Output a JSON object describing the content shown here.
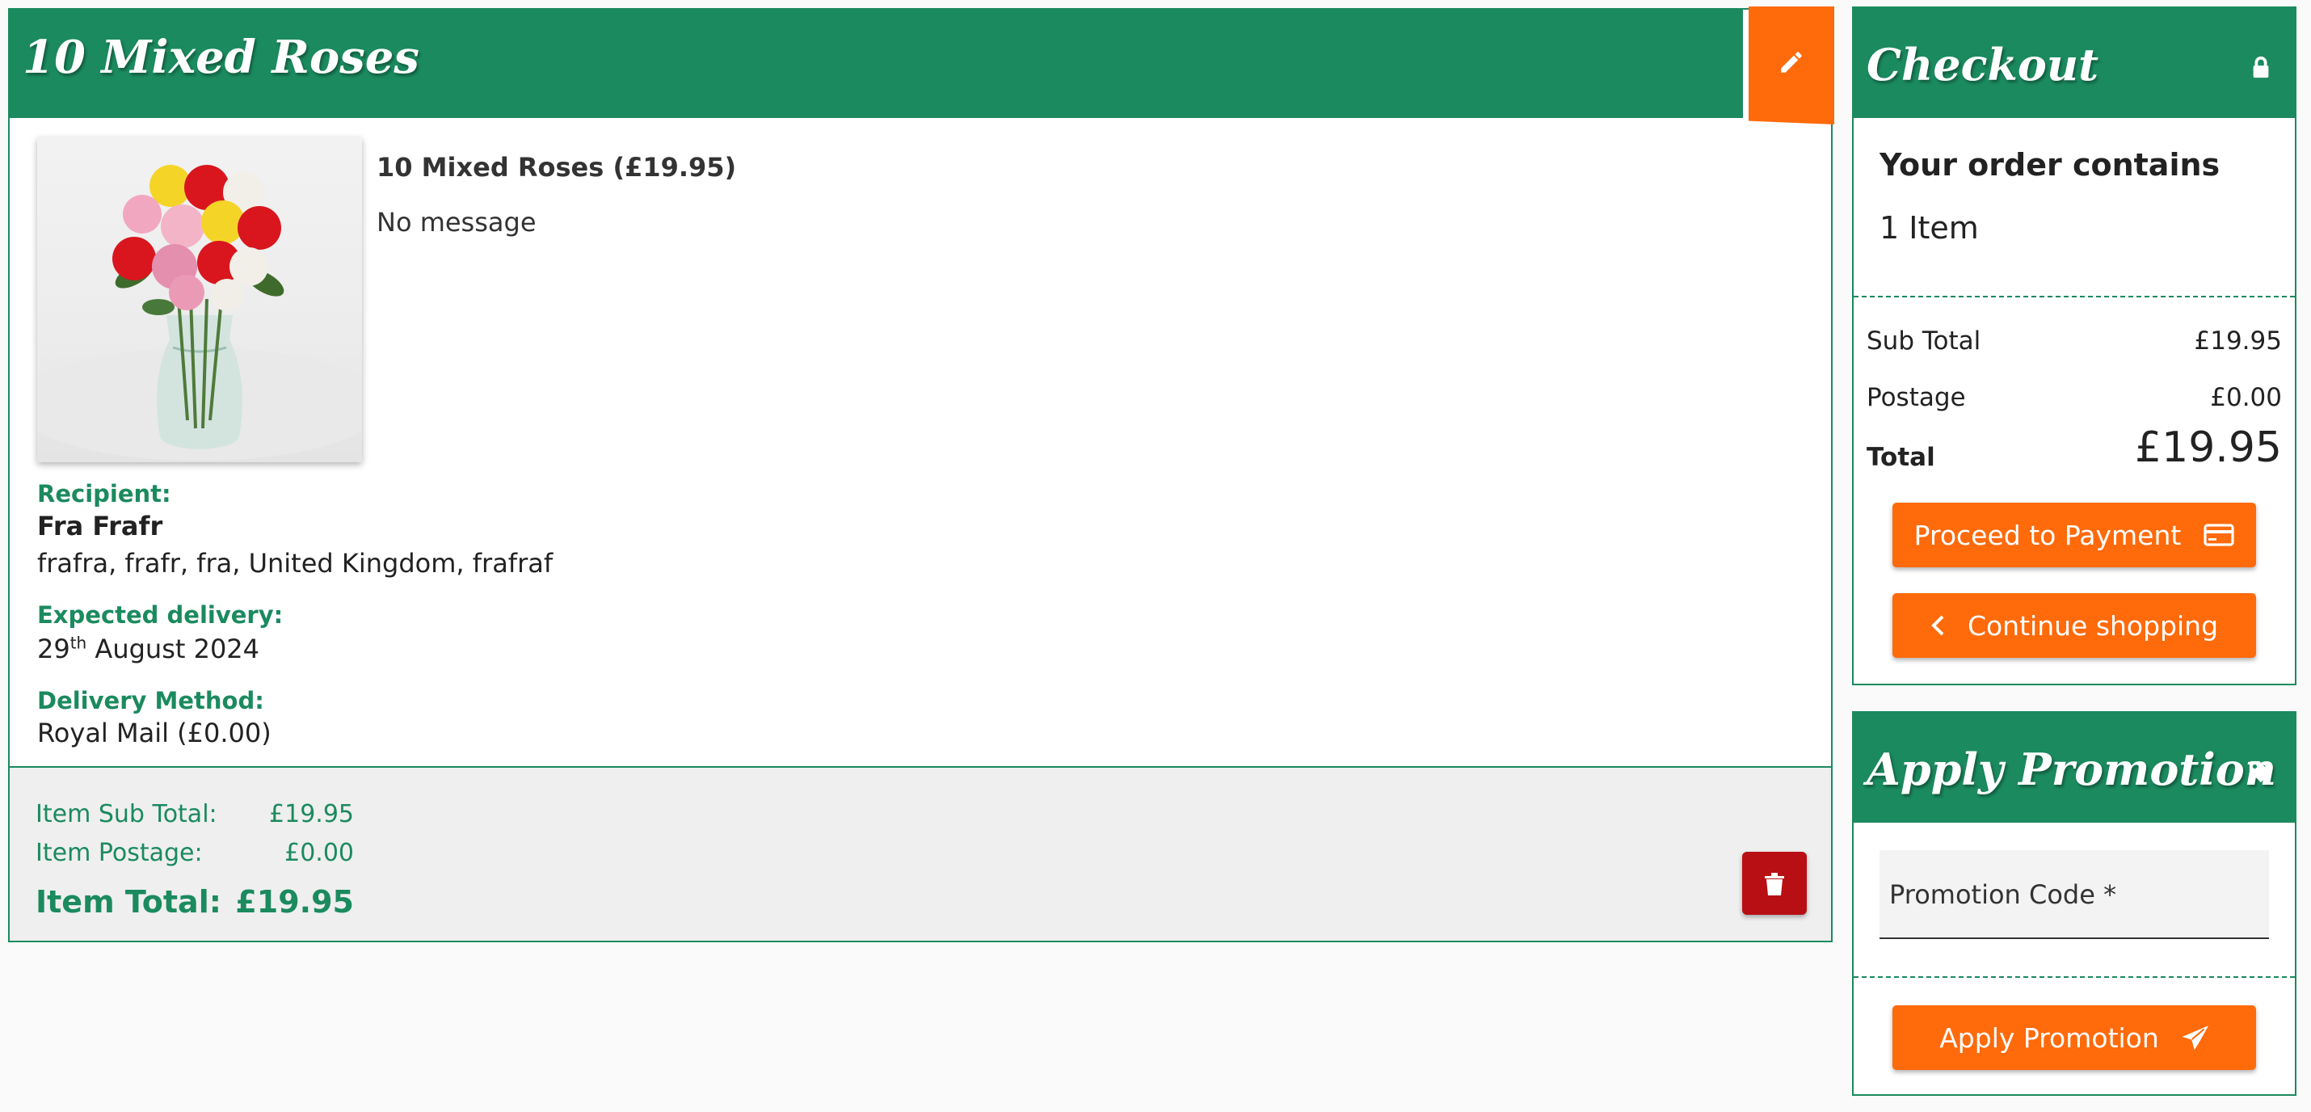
{
  "item": {
    "title": "10 Mixed Roses",
    "product_line": "10 Mixed Roses (£19.95)",
    "message": "No message",
    "recipient_label": "Recipient:",
    "recipient_name": "Fra Frafr",
    "recipient_address": "frafra, frafr, fra, United Kingdom, frafraf",
    "delivery_label": "Expected delivery:",
    "delivery_day": "29",
    "delivery_suffix": "th",
    "delivery_rest": " August 2024",
    "method_label": "Delivery Method:",
    "method_value": "Royal Mail (£0.00)",
    "subtotal_label": "Item Sub Total:",
    "subtotal_value": "£19.95",
    "postage_label": "Item Postage:",
    "postage_value": "£0.00",
    "total_label": "Item Total:",
    "total_value": "£19.95"
  },
  "checkout": {
    "title": "Checkout",
    "order_heading": "Your order contains",
    "order_count": "1 Item",
    "subtotal_label": "Sub Total",
    "subtotal_value": "£19.95",
    "postage_label": "Postage",
    "postage_value": "£0.00",
    "total_label": "Total",
    "total_value": "£19.95",
    "proceed_label": "Proceed to Payment",
    "continue_label": "Continue shopping"
  },
  "promotion": {
    "title": "Apply Promotion",
    "field_label": "Promotion Code *",
    "button_label": "Apply Promotion"
  },
  "colors": {
    "brand_green": "#1b8a5f",
    "accent_orange": "#ff6a0a",
    "delete_red": "#b80f14"
  },
  "icons": {
    "edit": "pencil-icon",
    "lock": "lock-icon",
    "card": "credit-card-icon",
    "back": "chevron-left-icon",
    "tag": "tag-icon",
    "send": "paper-plane-icon",
    "delete": "trash-icon"
  }
}
